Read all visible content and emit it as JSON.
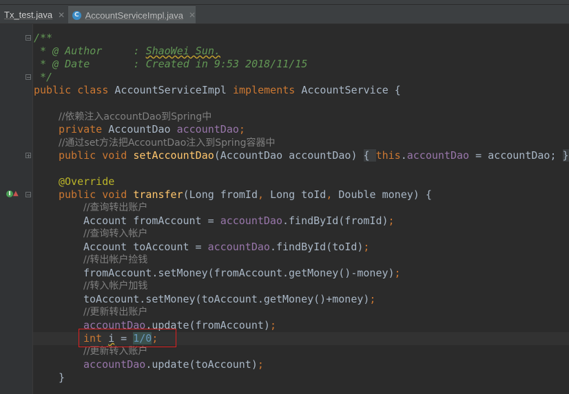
{
  "tabs": [
    {
      "label": "Tx_test.java",
      "active": false
    },
    {
      "label": "AccountServiceImpl.java",
      "active": true,
      "icon": "C"
    }
  ],
  "code": {
    "doc_open": "/**",
    "author_tag": " * @ Author",
    "author_colon": ":",
    "author_value": "ShaoWei Sun.",
    "date_tag": " * @ Date",
    "date_colon": ":",
    "date_value": "Created in 9:53 2018/11/15",
    "doc_close": " */",
    "class_kw": "public class ",
    "class_name": "AccountServiceImpl ",
    "implements_kw": "implements ",
    "iface_name": "AccountService {",
    "c1": "//依赖注入accountDao到Spring中",
    "private_kw": "private ",
    "dao_type": "AccountDao ",
    "dao_field": "accountDao",
    "semi": ";",
    "c2": "//通过set方法把AccountDao注入到Spring容器中",
    "public_void": "public void ",
    "setter_name": "setAccountDao",
    "setter_params": "(AccountDao accountDao) ",
    "brace_open": "{ ",
    "this_kw": "this",
    "dot": ".",
    "setter_field": "accountDao",
    "setter_assign": " = accountDao; ",
    "brace_close": "}",
    "override": "@Override",
    "public_void2": "public void ",
    "transfer_name": "transfer",
    "transfer_params_a": "(Long fromId",
    "comma1": ", ",
    "transfer_params_b": "Long toId",
    "comma2": ", ",
    "transfer_params_c": "Double money) {",
    "c3": "//查询转出账户",
    "l_from_a": "Account fromAccount = ",
    "l_from_b": "accountDao",
    "l_from_c": ".findById(fromId)",
    "l_from_semi": ";",
    "c4": "//查询转入帐户",
    "l_to_a": "Account toAccount = ",
    "l_to_b": "accountDao",
    "l_to_c": ".findById(toId)",
    "l_to_semi": ";",
    "c5": "//转出帐户捡钱",
    "l_set1": "fromAccount.setMoney(fromAccount.getMoney()-money)",
    "l_set1_semi": ";",
    "c6": "//转入帐户加钱",
    "l_set2": "toAccount.setMoney(toAccount.getMoney()+money)",
    "l_set2_semi": ";",
    "c7": "//更新转出账户",
    "l_upd1_a": "accountDao",
    "l_upd1_b": ".update(fromAccount)",
    "l_upd1_semi": ";",
    "int_kw": "int ",
    "int_var": "i",
    "int_eq": " = ",
    "int_val": "1/0",
    "int_semi": ";",
    "c8": "//更新转入账户",
    "l_upd2_a": "accountDao",
    "l_upd2_b": ".update(toAccount)",
    "l_upd2_semi": ";",
    "method_close": "}"
  },
  "colors": {
    "background": "#2b2b2b",
    "keyword": "#cc7832",
    "field": "#9876aa",
    "method": "#ffc66d",
    "comment": "#808080",
    "doc": "#629755",
    "annotation": "#bbb529",
    "number": "#6897bb",
    "highlight_box": "#e02020"
  }
}
